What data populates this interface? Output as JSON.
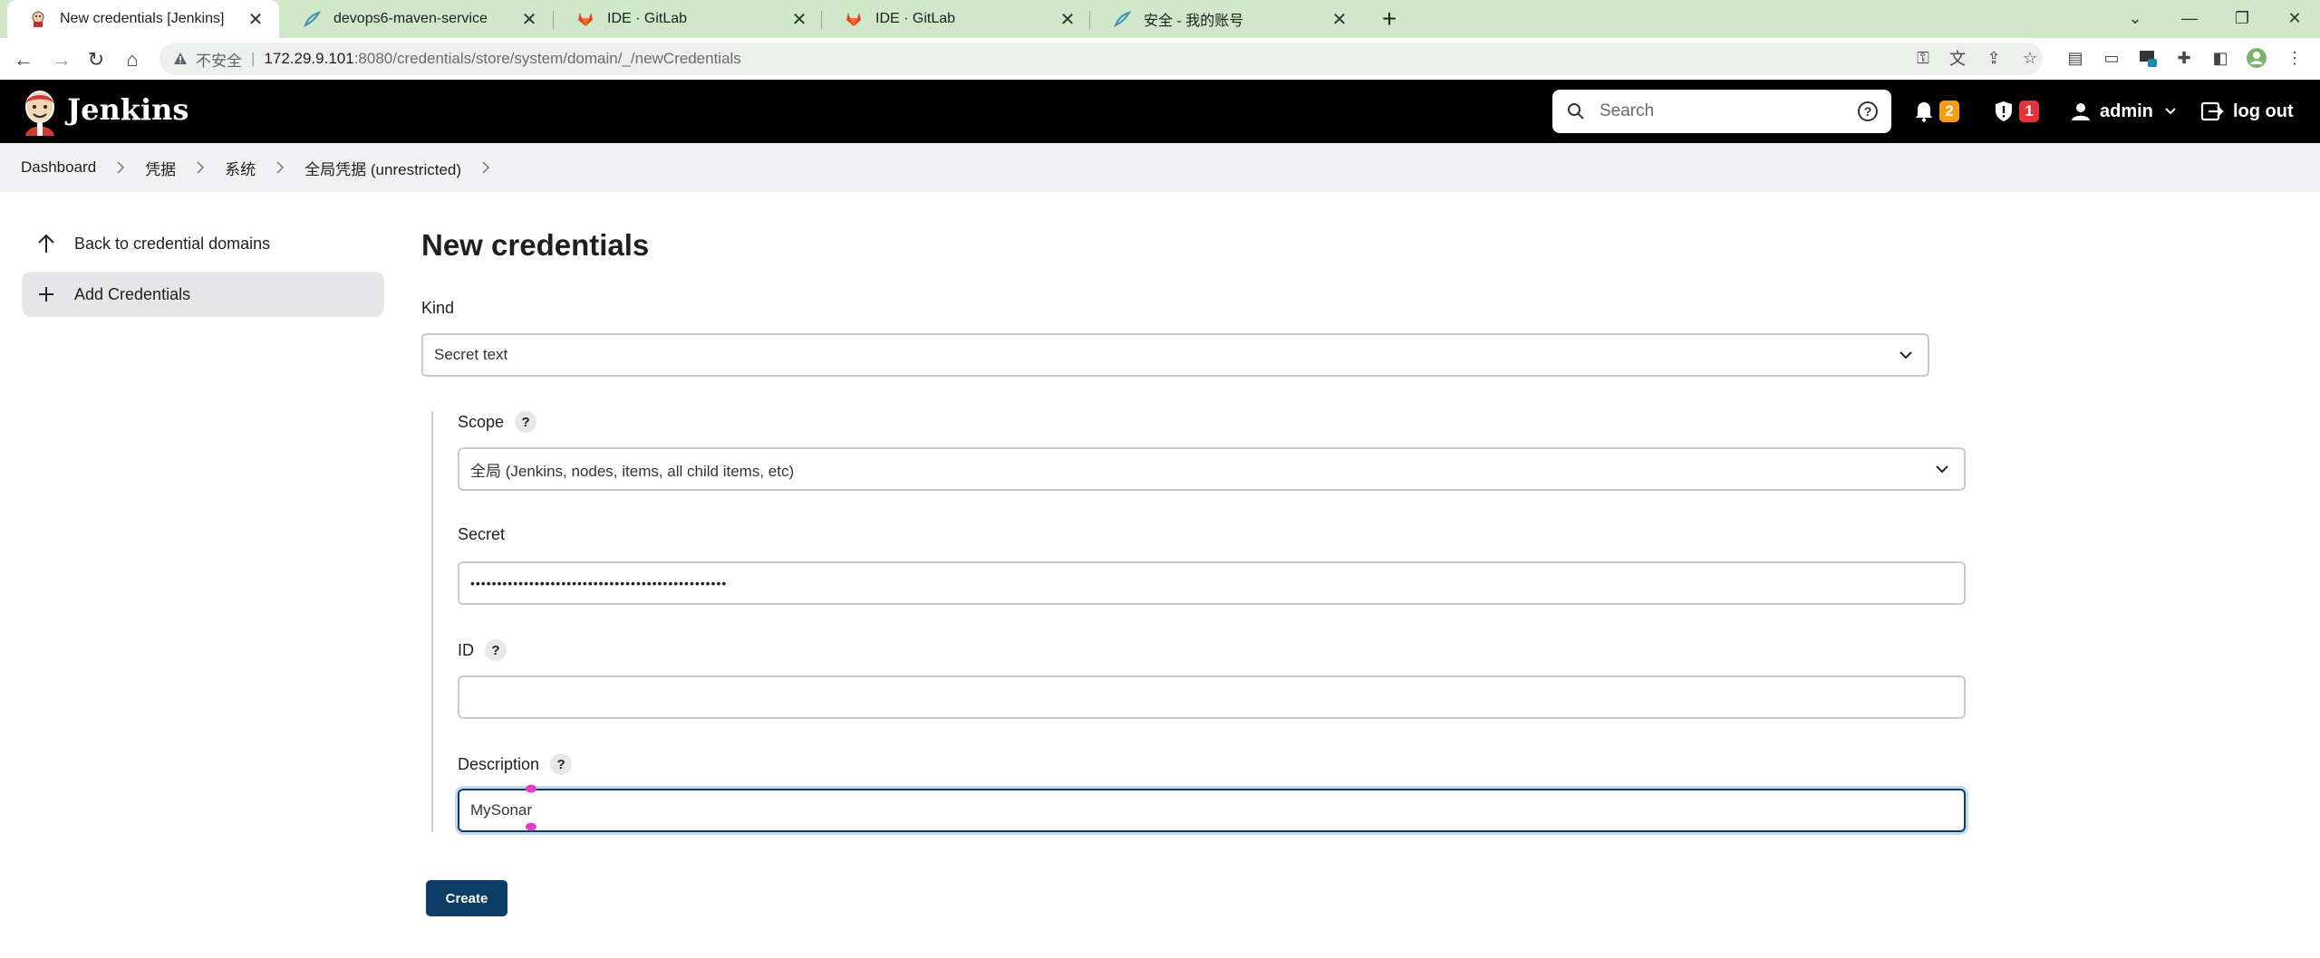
{
  "browser": {
    "tabs": [
      {
        "title": "New credentials [Jenkins]",
        "active": true,
        "favicon": "jenkins-icon"
      },
      {
        "title": "devops6-maven-service",
        "active": false,
        "favicon": "jenkins-feather-icon"
      },
      {
        "title": "IDE · GitLab",
        "active": false,
        "favicon": "gitlab-icon"
      },
      {
        "title": "IDE · GitLab",
        "active": false,
        "favicon": "gitlab-icon"
      },
      {
        "title": "安全 - 我的账号",
        "active": false,
        "favicon": "feather-icon"
      }
    ],
    "address": {
      "insecure_label": "不安全",
      "host": "172.29.9.101",
      "path": ":8080/credentials/store/system/domain/_/newCredentials"
    },
    "extension_badge": "1"
  },
  "header": {
    "brand": "Jenkins",
    "search_placeholder": "Search",
    "notifications_count": "2",
    "security_count": "1",
    "user": "admin",
    "logout": "log out",
    "colors": {
      "notification_badge": "#f59c1b",
      "security_badge": "#e5323d"
    }
  },
  "breadcrumb": [
    "Dashboard",
    "凭据",
    "系统",
    "全局凭据 (unrestricted)"
  ],
  "sidebar": {
    "items": [
      {
        "label": "Back to credential domains",
        "icon": "arrow-up-icon"
      },
      {
        "label": "Add Credentials",
        "icon": "plus-icon"
      }
    ]
  },
  "form": {
    "title": "New credentials",
    "kind": {
      "label": "Kind",
      "value": "Secret text"
    },
    "scope": {
      "label": "Scope",
      "value": "全局 (Jenkins, nodes, items, all child items, etc)"
    },
    "secret": {
      "label": "Secret",
      "value": "••••••••••••••••••••••••••••••••••••••••••••••••"
    },
    "id": {
      "label": "ID",
      "value": ""
    },
    "description": {
      "label": "Description",
      "value": "MySonar"
    },
    "help_glyph": "?",
    "submit": "Create"
  }
}
